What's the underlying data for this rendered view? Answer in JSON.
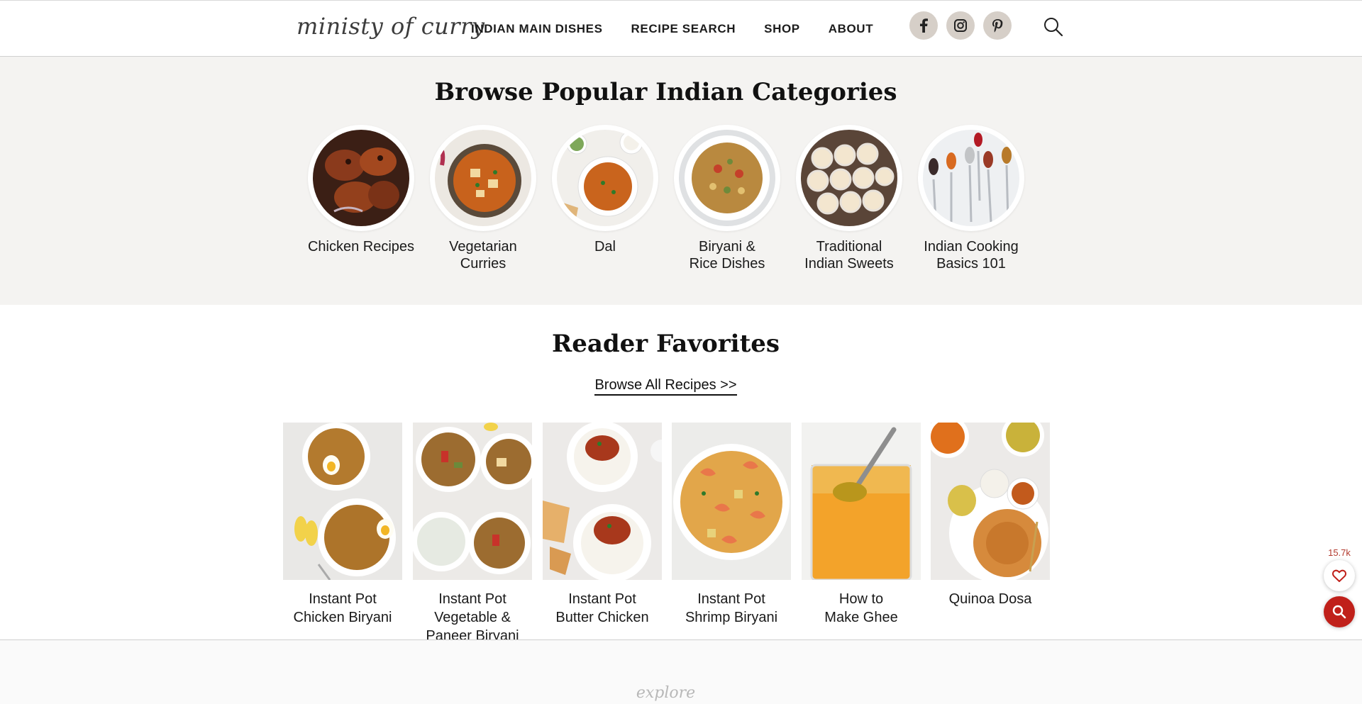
{
  "header": {
    "logo_text": "ministy of curry",
    "nav": [
      "INDIAN MAIN DISHES",
      "RECIPE SEARCH",
      "SHOP",
      "ABOUT"
    ],
    "social_icons": [
      "facebook-icon",
      "instagram-icon",
      "pinterest-icon"
    ],
    "search_icon": "search-icon"
  },
  "categories": {
    "heading": "Browse Popular Indian Categories",
    "items": [
      {
        "label": "Chicken Recipes",
        "image": "grilled-chicken"
      },
      {
        "label": "Vegetarian\nCurries",
        "image": "paneer-curry"
      },
      {
        "label": "Dal",
        "image": "dal-bowl"
      },
      {
        "label": "Biryani &\nRice Dishes",
        "image": "biryani-plate"
      },
      {
        "label": "Traditional\nIndian Sweets",
        "image": "sweets-tray"
      },
      {
        "label": "Indian Cooking\nBasics 101",
        "image": "spice-spoons"
      }
    ]
  },
  "favorites": {
    "heading": "Reader Favorites",
    "browse_link": "Browse All Recipes >>",
    "items": [
      {
        "title": "Instant Pot\nChicken Biryani",
        "image": "chicken-biryani"
      },
      {
        "title": "Instant Pot\nVegetable &\nPaneer Biryani",
        "image": "veg-biryani"
      },
      {
        "title": "Instant Pot\nButter Chicken",
        "image": "butter-chicken"
      },
      {
        "title": "Instant Pot\nShrimp Biryani",
        "image": "shrimp-biryani"
      },
      {
        "title": "How to\nMake Ghee",
        "image": "ghee-jar"
      },
      {
        "title": "Quinoa Dosa",
        "image": "quinoa-dosa"
      }
    ]
  },
  "footer": {
    "explore_text": "explore"
  },
  "floating": {
    "share_count": "15.7k",
    "heart_icon": "heart-icon",
    "search_icon": "search-icon"
  },
  "colors": {
    "beige_bg": "#f4f3f1",
    "social_bg": "#d6cfc8",
    "accent_red": "#c0201a",
    "count_red": "#b23a2e"
  }
}
